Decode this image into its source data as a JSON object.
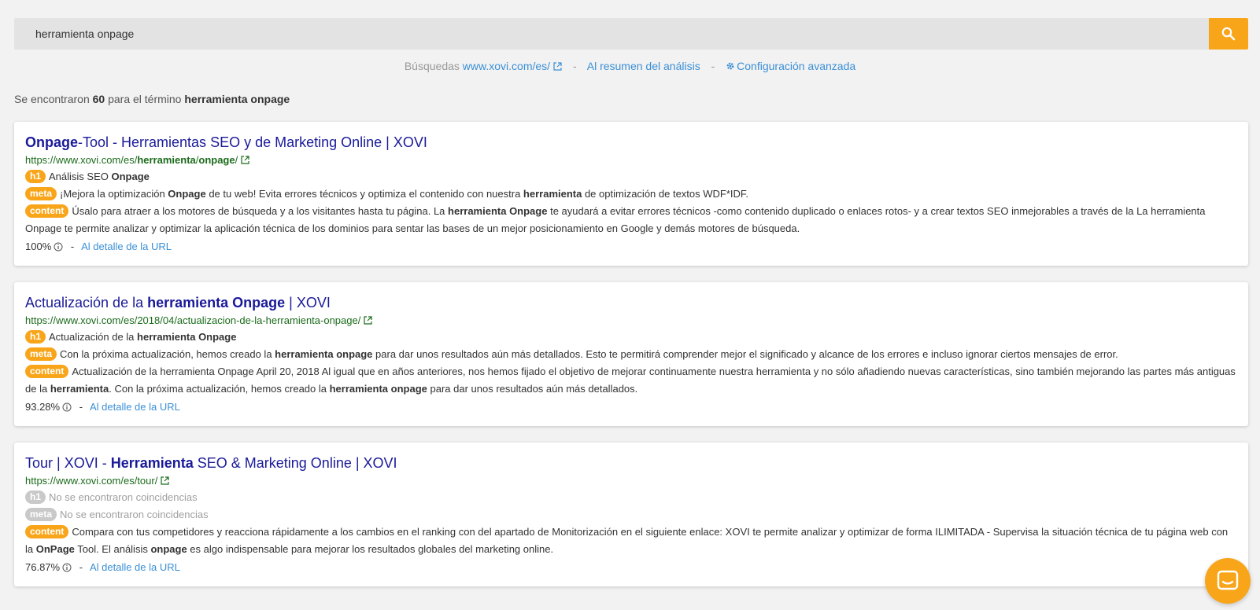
{
  "search": {
    "value": "herramienta onpage",
    "button_icon": "search-icon"
  },
  "links": {
    "busquedas_label": "Búsquedas",
    "domain_link": "www.xovi.com/es/",
    "resumen_link": "Al resumen del análisis",
    "config_link": "Configuración avanzada",
    "separator": "-"
  },
  "summary": {
    "prefix": "Se encontraron",
    "count": "60",
    "middle": "para el término",
    "term": "herramienta onpage"
  },
  "results": [
    {
      "title_a": "Onpage",
      "title_b": "-Tool - Herramientas SEO y de Marketing Online | XOVI",
      "url_a": "https://www.xovi.com/es/",
      "url_b": "herramienta",
      "url_c": "/",
      "url_d": "onpage",
      "url_e": "/",
      "h1_tag": "h1",
      "h1_a": "Análisis SEO ",
      "h1_b": "Onpage",
      "meta_tag": "meta",
      "meta_a": "¡Mejora la optimización ",
      "meta_b": "Onpage",
      "meta_c": " de tu web! Evita errores técnicos y optimiza el contenido con nuestra ",
      "meta_d": "herramienta",
      "meta_e": " de optimización de textos WDF*IDF.",
      "content_tag": "content",
      "content_a": "Úsalo para atraer a los motores de búsqueda y a los visitantes hasta tu página. La ",
      "content_b": "herramienta Onpage",
      "content_c": " te ayudará a evitar errores técnicos -como contenido duplicado o enlaces rotos- y a crear textos SEO inmejorables a través de la La herramienta Onpage te permite analizar y optimizar la aplicación técnica de los dominios para sentar las bases de un mejor posicionamiento en Google y demás motores de búsqueda.",
      "score": "100%",
      "detail_link": "Al detalle de la URL"
    },
    {
      "title_a": "Actualización de la ",
      "title_b": "herramienta Onpage",
      "title_c": " | XOVI",
      "url": "https://www.xovi.com/es/2018/04/actualizacion-de-la-herramienta-onpage/",
      "h1_tag": "h1",
      "h1_a": "Actualización de la ",
      "h1_b": "herramienta Onpage",
      "meta_tag": "meta",
      "meta_a": "Con la próxima actualización, hemos creado la ",
      "meta_b": "herramienta onpage",
      "meta_c": " para dar unos resultados aún más detallados. Esto te permitirá comprender mejor el significado y alcance de los errores e incluso ignorar ciertos mensajes de error.",
      "content_tag": "content",
      "content_a": "Actualización de la herramienta Onpage April 20, 2018 Al igual que en años anteriores, nos hemos fijado el objetivo de mejorar continuamente nuestra herramienta y no sólo añadiendo nuevas características, sino también mejorando las partes más antiguas de la ",
      "content_b": "herramienta",
      "content_c": ". Con la próxima actualización, hemos creado la ",
      "content_d": "herramienta onpage",
      "content_e": " para dar unos resultados aún más detallados.",
      "score": "93.28%",
      "detail_link": "Al detalle de la URL"
    },
    {
      "title_a": "Tour | XOVI - ",
      "title_b": "Herramienta",
      "title_c": " SEO & Marketing Online | XOVI",
      "url": "https://www.xovi.com/es/tour/",
      "h1_tag": "h1",
      "h1_text": "No se encontraron coincidencias",
      "meta_tag": "meta",
      "meta_text": "No se encontraron coincidencias",
      "content_tag": "content",
      "content_a": "Compara con tus competidores y reacciona rápidamente a los cambios en el ranking con del apartado de Monitorización en el siguiente enlace: XOVI te permite analizar y optimizar de forma ILIMITADA - Supervisa la situación técnica de tu página web con la ",
      "content_b": "OnPage",
      "content_c": " Tool. El análisis ",
      "content_d": "onpage",
      "content_e": " es algo indispensable para mejorar los resultados globales del marketing online.",
      "score": "76.87%",
      "detail_link": "Al detalle de la URL"
    }
  ],
  "colors": {
    "accent": "#f9a51a",
    "title": "#1a1a99",
    "url": "#1b6b1b",
    "link": "#3a8fd6"
  },
  "chat_icon": "chat-icon"
}
